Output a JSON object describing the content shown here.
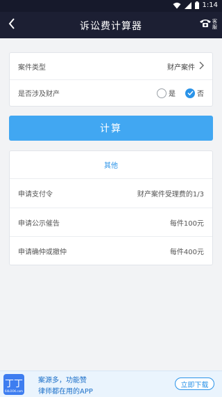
{
  "status_bar": {
    "time": "1:14"
  },
  "nav": {
    "title": "诉讼费计算器",
    "service_label": "客服"
  },
  "form": {
    "case_type_label": "案件类型",
    "case_type_value": "财产案件",
    "property_label": "是否涉及财产",
    "option_yes": "是",
    "option_no": "否",
    "selected": "否"
  },
  "calc_button": "计算",
  "other": {
    "title": "其他",
    "rows": [
      {
        "label": "申请支付令",
        "value": "财产案件受理费的1/3"
      },
      {
        "label": "申请公示催告",
        "value": "每件100元"
      },
      {
        "label": "申请确仲或撤仲",
        "value": "每件400元"
      }
    ]
  },
  "banner": {
    "logo_text": "丁丁",
    "logo_sub": "64LOOK.com",
    "line1": "案源多，功能赞",
    "line2": "律师都在用的APP",
    "download_label": "立即下载"
  },
  "colors": {
    "nav_bg": "#1c1f33",
    "accent": "#41a7f2",
    "link": "#2a93e8"
  }
}
